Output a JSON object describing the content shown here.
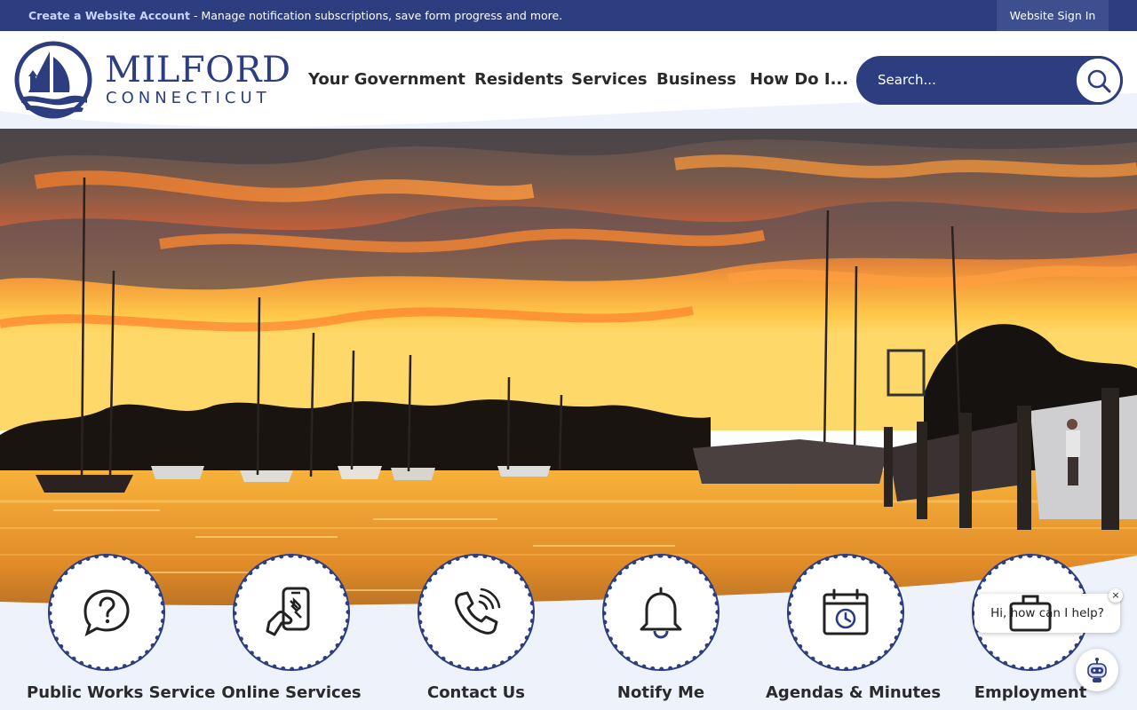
{
  "topbar": {
    "create_account_link": "Create a Website Account",
    "create_account_rest": " - Manage notification subscriptions, save form progress and more.",
    "sign_in": "Website Sign In"
  },
  "brand": {
    "name_line1": "MILFORD",
    "name_line2": "CONNECTICUT"
  },
  "nav": {
    "items": [
      "Your Government",
      "Residents",
      "Services",
      "Business",
      "How Do I..."
    ]
  },
  "search": {
    "placeholder": "Search..."
  },
  "quick_links": [
    {
      "label": "Public Works Service",
      "icon": "question-bubble-icon"
    },
    {
      "label": "Online Services",
      "icon": "phone-tools-icon"
    },
    {
      "label": "Contact Us",
      "icon": "phone-call-icon"
    },
    {
      "label": "Notify Me",
      "icon": "bell-icon"
    },
    {
      "label": "Agendas & Minutes",
      "icon": "calendar-clock-icon"
    },
    {
      "label": "Employment",
      "icon": "briefcase-icon"
    }
  ],
  "chat": {
    "greeting": "Hi, how can I help?",
    "close_glyph": "×"
  },
  "colors": {
    "navy": "#2c3e80",
    "band": "#eef2fb"
  }
}
